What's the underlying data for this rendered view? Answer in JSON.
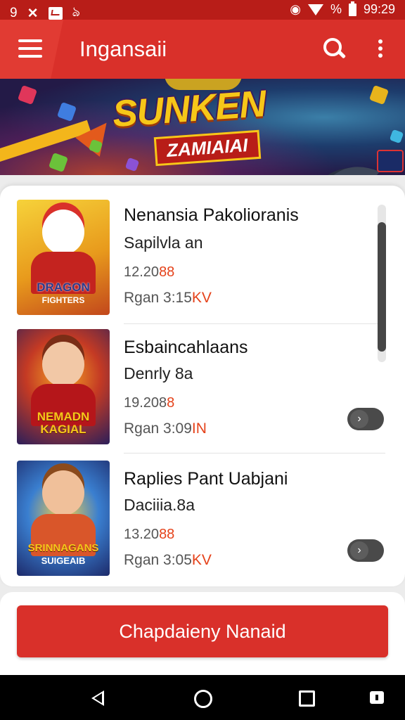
{
  "status_bar": {
    "left_text": "9",
    "percent_symbol": "%",
    "time": "99:29"
  },
  "app_bar": {
    "title": "Ingansaii"
  },
  "banner": {
    "logo_line1": "SUNKEN",
    "logo_line2": "ZAMIAIAI"
  },
  "list": {
    "items": [
      {
        "title": "Nenansia Pakolioranis",
        "subtitle": "Sapilvla an",
        "number_main": "12.20",
        "number_hl": "88",
        "meta_main": "Rgan 3:15",
        "meta_hl": "KV",
        "thumb_caption_1": "DRAGON",
        "thumb_caption_2": "FIGHTERS"
      },
      {
        "title": "Esbaincahlaans",
        "subtitle": "Denrly 8a",
        "number_main": "19.208",
        "number_hl": "8",
        "meta_main": "Rgan 3:09",
        "meta_hl": "IN",
        "thumb_caption_1": "NEMADN",
        "thumb_caption_2": "KAGIAL"
      },
      {
        "title": "Raplies Pant Uabjani",
        "subtitle": "Daciiia.8a",
        "number_main": "13.20",
        "number_hl": "88",
        "meta_main": "Rgan 3:05",
        "meta_hl": "KV",
        "thumb_caption_1": "SRINNAGANS",
        "thumb_caption_2": "SUIGEAIB"
      }
    ]
  },
  "cta": {
    "label": "Chapdaieny Nanaid"
  },
  "icons": {
    "menu": "hamburger-icon",
    "search": "search-icon",
    "more": "more-vertical-icon",
    "back": "back-triangle-icon",
    "home": "home-circle-icon",
    "recents": "recents-square-icon"
  },
  "colors": {
    "primary": "#d9302a",
    "status_bar": "#b81d18",
    "accent_text": "#e5421a"
  }
}
